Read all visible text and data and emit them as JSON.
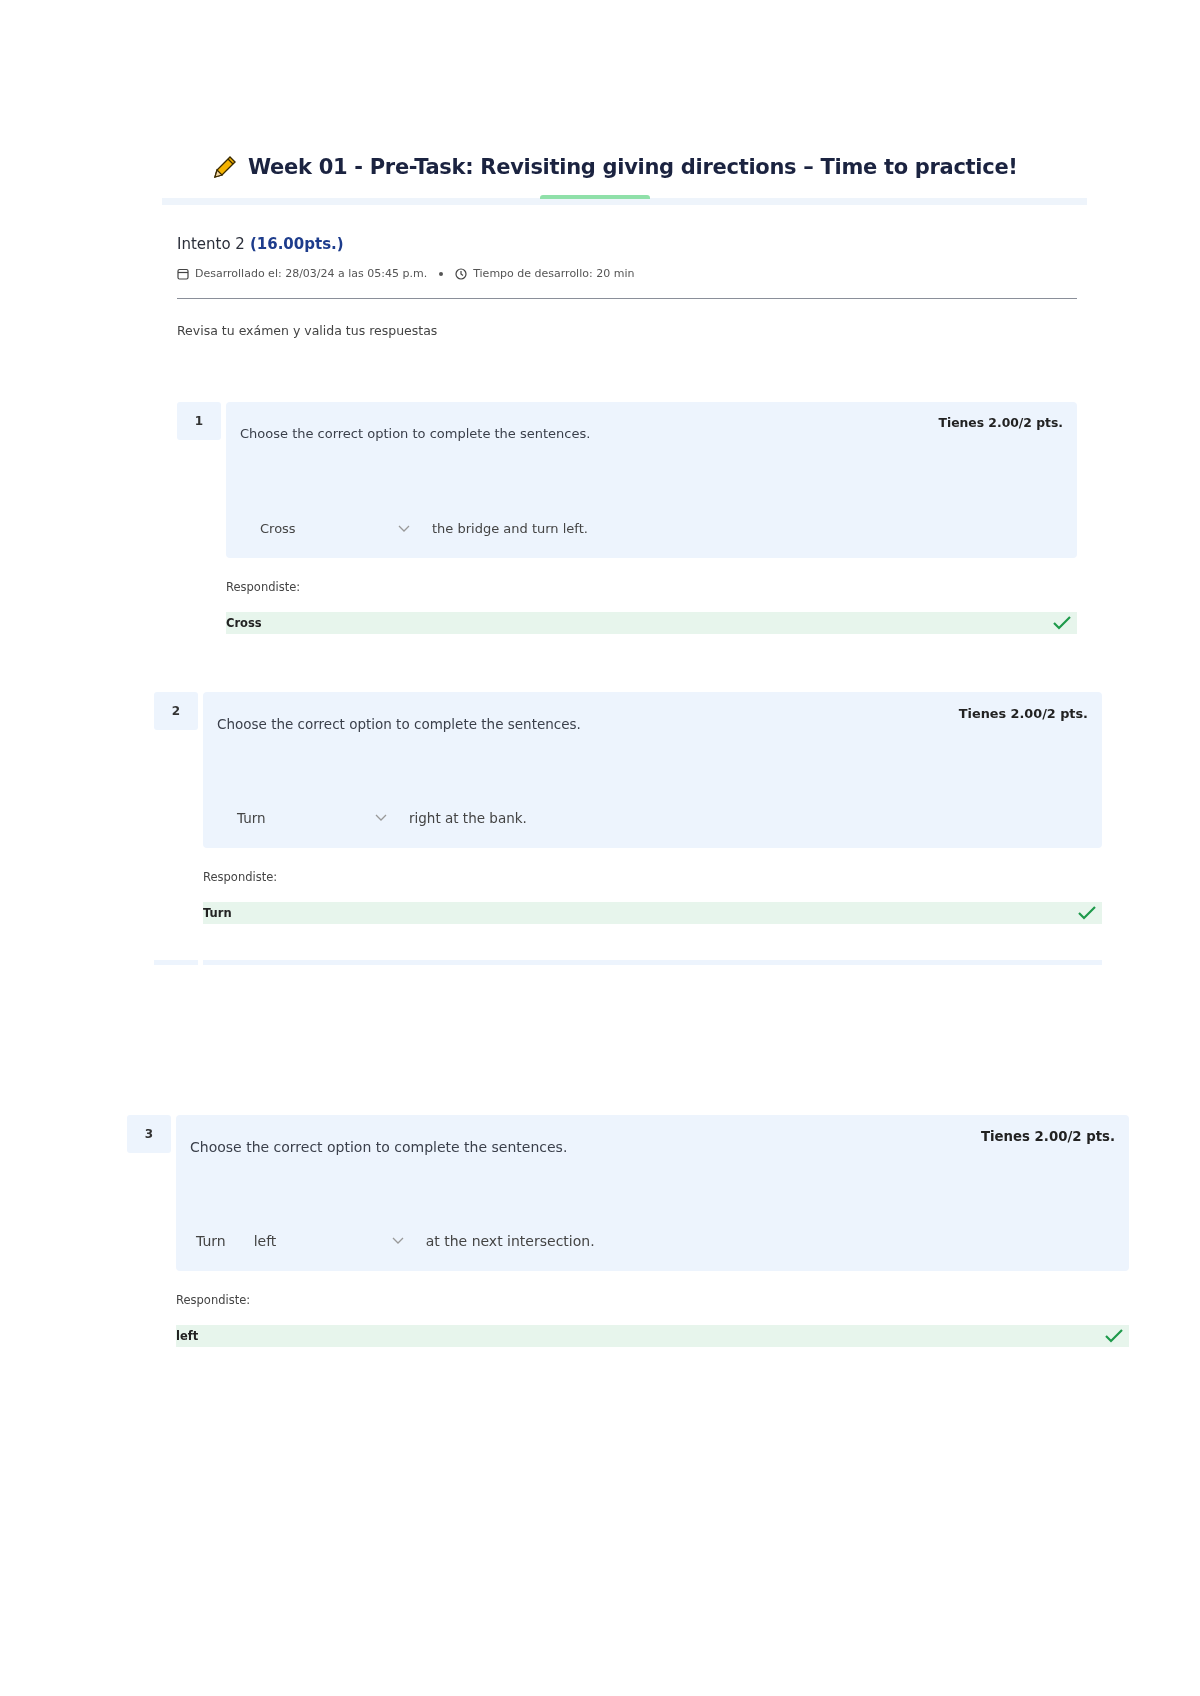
{
  "header": {
    "title": "Week 01 - Pre-Task: Revisiting giving directions – Time to practice!"
  },
  "attempt": {
    "label": "Intento 2",
    "score": "(16.00pts.)",
    "developed": "Desarrollado el: 28/03/24 a las 05:45 p.m.",
    "duration": "Tiempo de desarrollo: 20 min"
  },
  "instructions": "Revisa tu exámen y valida tus respuestas",
  "questions": [
    {
      "number": "1",
      "prompt": "Choose the correct option to complete the sentences.",
      "score": "Tienes 2.00/2 pts.",
      "answer": {
        "value": "Cross",
        "after": "the bridge and turn left."
      },
      "answered_label": "Respondiste:",
      "response": "Cross",
      "correct": true
    },
    {
      "number": "2",
      "prompt": "Choose the correct option to complete the sentences.",
      "score": "Tienes 2.00/2 pts.",
      "answer": {
        "value": "Turn",
        "after": "right at the bank."
      },
      "answered_label": "Respondiste:",
      "response": "Turn",
      "correct": true
    },
    {
      "number": "3",
      "prompt": "Choose the correct option to complete the sentences.",
      "score": "Tienes 2.00/2 pts.",
      "answer": {
        "before": "Turn",
        "value": "left",
        "after": "at the next intersection."
      },
      "answered_label": "Respondiste:",
      "response": "left",
      "correct": true
    }
  ]
}
